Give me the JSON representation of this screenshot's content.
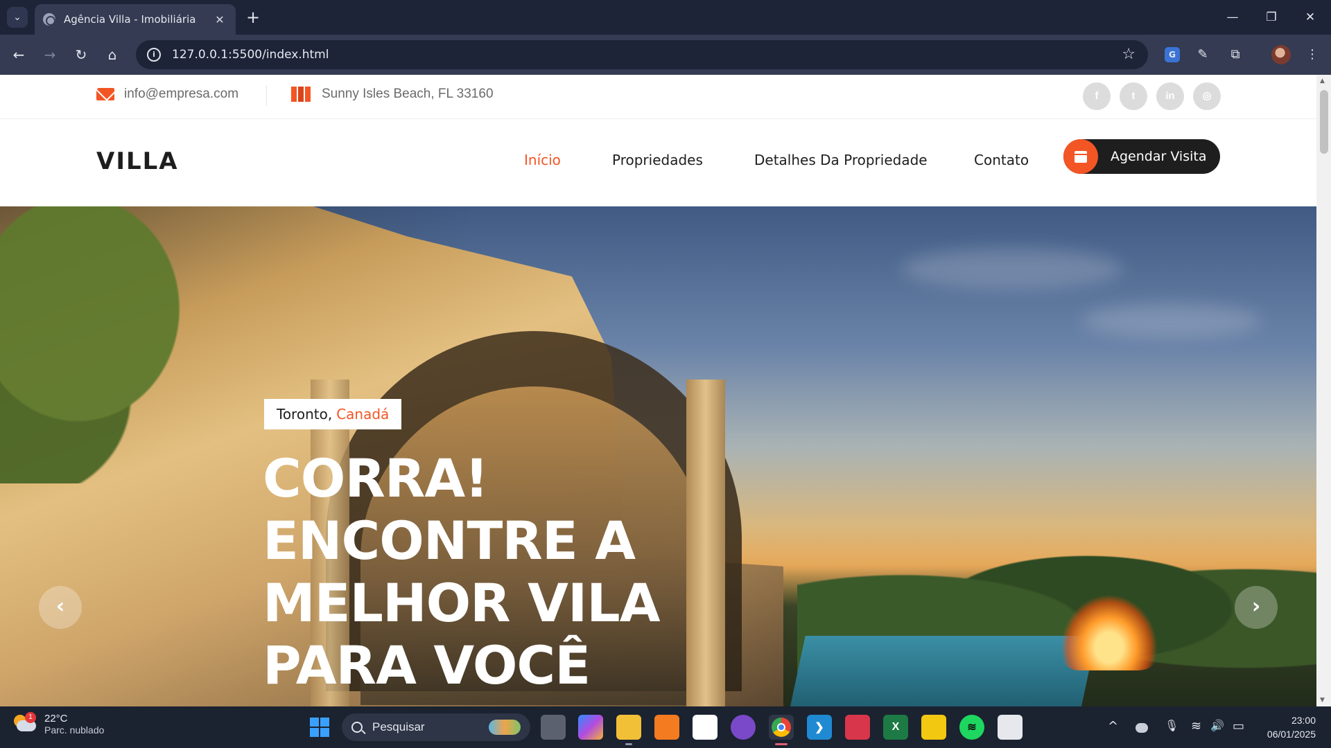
{
  "browser": {
    "tab_title": "Agência Villa - Imobiliária",
    "url": "127.0.0.1:5500/index.html",
    "new_tab_symbol": "+",
    "tab_close_symbol": "✕",
    "tab_list_symbol": "⌄",
    "win_controls": {
      "minimize": "—",
      "maximize": "❐",
      "close": "✕"
    },
    "nav": {
      "back": "←",
      "forward": "→",
      "reload": "↻",
      "home": "⌂"
    },
    "star": "☆",
    "extensions": {
      "translate": "G",
      "eyedropper": "✎",
      "puzzle": "⧉",
      "menu": "⋮"
    }
  },
  "topbar": {
    "email": "info@empresa.com",
    "address": "Sunny Isles Beach, FL 33160",
    "social": [
      {
        "name": "facebook",
        "glyph": "f"
      },
      {
        "name": "twitter",
        "glyph": "t"
      },
      {
        "name": "linkedin",
        "glyph": "in"
      },
      {
        "name": "instagram",
        "glyph": "◎"
      }
    ]
  },
  "header": {
    "logo": "VILLA",
    "nav": [
      {
        "label": "Início",
        "active": true
      },
      {
        "label": "Propriedades",
        "active": false
      },
      {
        "label": "Detalhes Da Propriedade",
        "active": false
      },
      {
        "label": "Contato",
        "active": false
      }
    ],
    "cta_label": "Agendar Visita"
  },
  "hero": {
    "city": "Toronto,",
    "country": "Canadá",
    "title_lines": [
      "CORRA!",
      "ENCONTRE A",
      "MELHOR VILA",
      "PARA VOCÊ"
    ],
    "prev_symbol": "‹",
    "next_symbol": "›"
  },
  "taskbar": {
    "weather_temp": "22°C",
    "weather_cond": "Parc. nublado",
    "weather_badge": "1",
    "search_placeholder": "Pesquisar",
    "apps": [
      "task-view",
      "copilot",
      "file-explorer",
      "xampp",
      "microsoft-store",
      "github-desktop",
      "chrome",
      "vscode",
      "screen-recorder",
      "excel",
      "power-bi",
      "spotify",
      "snipping-tool"
    ],
    "app_glyphs": {
      "excel": "X",
      "vscode": "❯",
      "spotify": "≋"
    },
    "time": "23:00",
    "date": "06/01/2025",
    "tray": {
      "chevron": "^",
      "mic": "🎙",
      "wifi": "≋",
      "volume": "🔊",
      "battery": "▭"
    }
  },
  "colors": {
    "accent": "#f35525",
    "dark": "#1e1e1e",
    "chrome_bg": "#1d2437",
    "chrome_toolbar": "#343b52"
  }
}
